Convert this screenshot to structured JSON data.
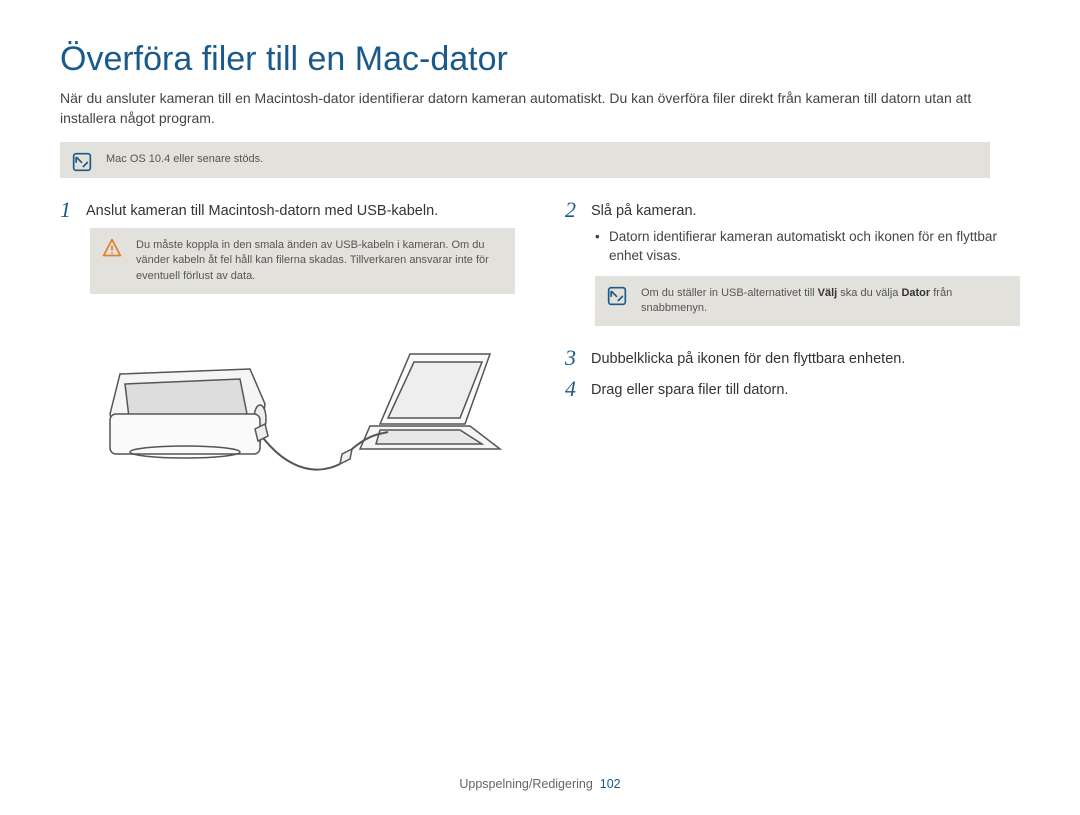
{
  "title": "Överföra filer till en Mac-dator",
  "intro": "När du ansluter kameran till en Macintosh-dator identifierar datorn kameran automatiskt. Du kan överföra filer direkt från kameran till datorn utan att installera något program.",
  "topNote": "Mac OS 10.4 eller senare stöds.",
  "left": {
    "step1_num": "1",
    "step1": "Anslut kameran till Macintosh-datorn med USB-kabeln.",
    "warn": "Du måste koppla in den smala änden av USB-kabeln i kameran. Om du vänder kabeln åt fel håll kan filerna skadas. Tillverkaren ansvarar inte för eventuell förlust av data."
  },
  "right": {
    "step2_num": "2",
    "step2": "Slå på kameran.",
    "bullet": "Datorn identifierar kameran automatiskt och ikonen för en flyttbar enhet visas.",
    "note_pre": "Om du ställer in USB-alternativet till ",
    "note_b1": "Välj",
    "note_mid": " ska du välja ",
    "note_b2": "Dator",
    "note_post": " från snabbmenyn.",
    "step3_num": "3",
    "step3": "Dubbelklicka på ikonen för den flyttbara enheten.",
    "step4_num": "4",
    "step4": "Drag eller spara filer till datorn."
  },
  "footer": {
    "section": "Uppspelning/Redigering",
    "page": "102"
  }
}
